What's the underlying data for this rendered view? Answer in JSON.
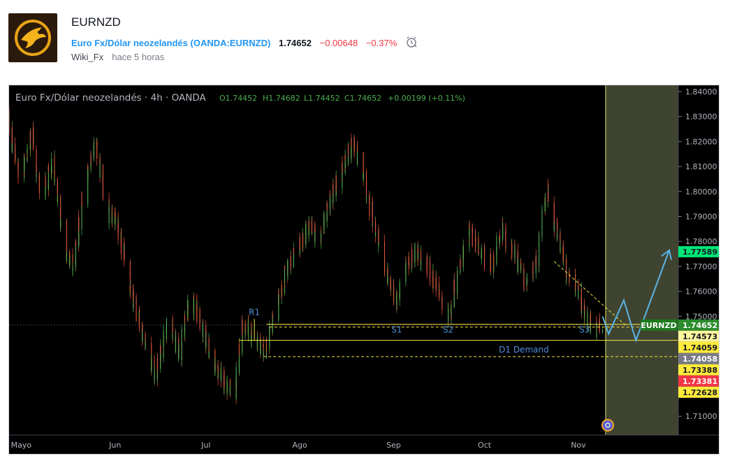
{
  "idea": {
    "symbol": "EURNZD",
    "instrument_name": "Euro Fx/Dólar neozelandés",
    "instrument_code": "OANDA:EURNZD",
    "last_price": "1.74652",
    "change": "−0.00648",
    "change_pct": "−0.37%",
    "author": "Wiki_Fx",
    "published": "hace 5 horas"
  },
  "chart_data": {
    "type": "candlestick",
    "title": "Euro Fx/Dólar neozelandés · 4h · OANDA",
    "ohlc_label": {
      "o": "O1.74452",
      "h": "H1.74682",
      "l": "L1.74452",
      "c": "C1.74652",
      "chg": "+0.00199 (+0.11%)"
    },
    "x_axis": {
      "labels": [
        "Mayo",
        "Jun",
        "Jul",
        "Ago",
        "Sep",
        "Oct",
        "Nov"
      ],
      "range": [
        "2021-04-27",
        "2021-12-04"
      ]
    },
    "y_axis": {
      "range": [
        1.7025,
        1.8425
      ],
      "ticks": [
        "1.84000",
        "1.83000",
        "1.82000",
        "1.81000",
        "1.80000",
        "1.79000",
        "1.78000",
        "1.77000",
        "1.76000",
        "1.75000",
        "1.74000",
        "1.73000",
        "1.72000",
        "1.71000"
      ]
    },
    "price_path": [
      [
        "2021-04-27",
        1.828
      ],
      [
        "2021-05-01",
        1.806
      ],
      [
        "2021-05-05",
        1.823
      ],
      [
        "2021-05-08",
        1.796
      ],
      [
        "2021-05-12",
        1.812
      ],
      [
        "2021-05-16",
        1.775
      ],
      [
        "2021-05-19",
        1.77
      ],
      [
        "2021-05-22",
        1.8
      ],
      [
        "2021-05-26",
        1.82
      ],
      [
        "2021-05-30",
        1.792
      ],
      [
        "2021-06-02",
        1.788
      ],
      [
        "2021-06-05",
        1.77
      ],
      [
        "2021-06-09",
        1.75
      ],
      [
        "2021-06-12",
        1.735
      ],
      [
        "2021-06-15",
        1.726
      ],
      [
        "2021-06-19",
        1.748
      ],
      [
        "2021-06-23",
        1.735
      ],
      [
        "2021-06-26",
        1.758
      ],
      [
        "2021-06-29",
        1.751
      ],
      [
        "2021-07-03",
        1.733
      ],
      [
        "2021-07-07",
        1.725
      ],
      [
        "2021-07-11",
        1.72
      ],
      [
        "2021-07-14",
        1.748
      ],
      [
        "2021-07-17",
        1.742
      ],
      [
        "2021-07-21",
        1.735
      ],
      [
        "2021-07-25",
        1.755
      ],
      [
        "2021-07-28",
        1.768
      ],
      [
        "2021-08-01",
        1.778
      ],
      [
        "2021-08-04",
        1.785
      ],
      [
        "2021-08-08",
        1.782
      ],
      [
        "2021-08-11",
        1.795
      ],
      [
        "2021-08-15",
        1.807
      ],
      [
        "2021-08-19",
        1.82
      ],
      [
        "2021-08-22",
        1.81
      ],
      [
        "2021-08-26",
        1.787
      ],
      [
        "2021-08-29",
        1.772
      ],
      [
        "2021-09-02",
        1.755
      ],
      [
        "2021-09-05",
        1.769
      ],
      [
        "2021-09-09",
        1.776
      ],
      [
        "2021-09-12",
        1.771
      ],
      [
        "2021-09-16",
        1.761
      ],
      [
        "2021-09-19",
        1.747
      ],
      [
        "2021-09-23",
        1.768
      ],
      [
        "2021-09-26",
        1.786
      ],
      [
        "2021-09-30",
        1.776
      ],
      [
        "2021-10-04",
        1.771
      ],
      [
        "2021-10-07",
        1.784
      ],
      [
        "2021-10-11",
        1.776
      ],
      [
        "2021-10-15",
        1.763
      ],
      [
        "2021-10-19",
        1.772
      ],
      [
        "2021-10-22",
        1.801
      ],
      [
        "2021-10-25",
        1.786
      ],
      [
        "2021-10-29",
        1.766
      ],
      [
        "2021-11-01",
        1.762
      ],
      [
        "2021-11-04",
        1.75
      ],
      [
        "2021-11-07",
        1.745
      ],
      [
        "2021-11-09",
        1.7465
      ]
    ],
    "last_bar_date": "2021-11-09",
    "series": [
      {
        "name": "EURNZD",
        "last": "1.74652",
        "color": "#1e7a1e"
      }
    ],
    "levels": [
      {
        "price": 1.77589,
        "label": "1.77589",
        "color": "#00e676"
      },
      {
        "price": 1.74652,
        "label": "1.74652",
        "color": "#2a8c2a"
      },
      {
        "price": 1.74573,
        "label": "1.74573",
        "color": "#fff59d"
      },
      {
        "price": 1.74059,
        "label": "1.74059",
        "color": "#ffeb3b"
      },
      {
        "price": 1.74058,
        "label": "1.74058",
        "color": "#787b86"
      },
      {
        "price": 1.73388,
        "label": "1.73388",
        "color": "#ffeb3b"
      },
      {
        "price": 1.73381,
        "label": "1.73381",
        "color": "#f23645"
      },
      {
        "price": 1.72628,
        "label": "1.72628",
        "color": "#ffeb3b"
      }
    ],
    "annotations": [
      {
        "text": "R1",
        "date": "2021-07-17",
        "price": 1.7505
      },
      {
        "text": "S1",
        "date": "2021-09-02",
        "price": 1.7435
      },
      {
        "text": "S2",
        "date": "2021-09-19",
        "price": 1.7435
      },
      {
        "text": "S3",
        "date": "2021-11-03",
        "price": 1.7435
      },
      {
        "text": "D1 Demand",
        "date": "2021-10-14",
        "price": 1.7355
      }
    ],
    "zones": {
      "forecast_start": "2021-11-10",
      "support_box": {
        "from": "2021-07-21",
        "to": "2021-11-10",
        "top": 1.7468,
        "bottom": 1.7404
      },
      "projection_path": [
        [
          "2021-11-09",
          1.75
        ],
        [
          "2021-11-11",
          1.743
        ],
        [
          "2021-11-16",
          1.7565
        ],
        [
          "2021-11-20",
          1.7404
        ],
        [
          "2021-12-01",
          1.7765
        ]
      ],
      "trendline": [
        [
          "2021-10-24",
          1.772
        ],
        [
          "2021-11-17",
          1.746
        ]
      ],
      "position": {
        "from": "2021-12-04",
        "to": "2021-12-29",
        "entry": 1.7468,
        "target": 1.77589,
        "stop": 1.7404
      }
    },
    "colors": {
      "up": "#4caf50",
      "down": "#e0523a",
      "forecast_bg": "#3f4430",
      "profit": "#4caf50",
      "loss": "#e05a3a",
      "arrow": "#5ab4e6",
      "lines": "#f5e642"
    }
  }
}
